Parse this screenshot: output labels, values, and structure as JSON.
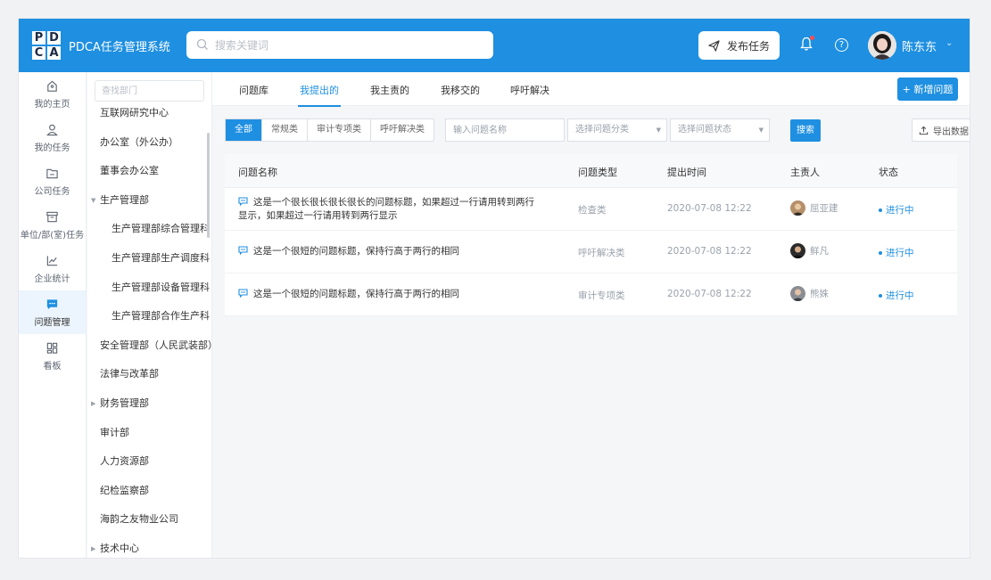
{
  "brand": {
    "logo_letters": [
      "P",
      "D",
      "C",
      "A"
    ],
    "title": "PDCA任务管理系统"
  },
  "header": {
    "search_placeholder": "搜索关键词",
    "publish_label": "发布任务",
    "user_name": "陈东东",
    "help_glyph": "?"
  },
  "nav": {
    "items": [
      {
        "label": "我的主页",
        "icon": "home-icon"
      },
      {
        "label": "我的任务",
        "icon": "user-icon"
      },
      {
        "label": "公司任务",
        "icon": "folder-icon"
      },
      {
        "label": "单位/部(室)任务",
        "icon": "archive-icon"
      },
      {
        "label": "企业统计",
        "icon": "chart-icon"
      },
      {
        "label": "问题管理",
        "icon": "message-icon",
        "active": true
      },
      {
        "label": "看板",
        "icon": "dashboard-icon"
      }
    ]
  },
  "dept": {
    "search_placeholder": "查找部门",
    "items": [
      {
        "label": "互联网研究中心",
        "level": 0
      },
      {
        "label": "办公室（外公办）",
        "level": 0
      },
      {
        "label": "董事会办公室",
        "level": 0
      },
      {
        "label": "生产管理部",
        "level": 0,
        "expanded": true
      },
      {
        "label": "生产管理部综合管理科",
        "level": 1
      },
      {
        "label": "生产管理部生产调度科",
        "level": 1
      },
      {
        "label": "生产管理部设备管理科",
        "level": 1
      },
      {
        "label": "生产管理部合作生产科",
        "level": 1
      },
      {
        "label": "安全管理部（人民武装部）",
        "level": 0
      },
      {
        "label": "法律与改革部",
        "level": 0
      },
      {
        "label": "财务管理部",
        "level": 0,
        "collapsed": true
      },
      {
        "label": "审计部",
        "level": 0
      },
      {
        "label": "人力资源部",
        "level": 0
      },
      {
        "label": "纪检监察部",
        "level": 0
      },
      {
        "label": "海韵之友物业公司",
        "level": 0
      },
      {
        "label": "技术中心",
        "level": 0,
        "collapsed": true
      }
    ]
  },
  "tabs": [
    "问题库",
    "我提出的",
    "我主责的",
    "我移交的",
    "呼吁解决"
  ],
  "active_tab": 1,
  "add_button": "+ 新增问题",
  "filters": {
    "segments": [
      "全部",
      "常规类",
      "审计专项类",
      "呼吁解决类"
    ],
    "active_segment": 0,
    "name_placeholder": "输入问题名称",
    "category_placeholder": "选择问题分类",
    "status_placeholder": "选择问题状态",
    "search_label": "搜索",
    "export_label": "导出数据"
  },
  "table": {
    "headers": [
      "问题名称",
      "问题类型",
      "提出时间",
      "主责人",
      "状态"
    ],
    "rows": [
      {
        "title": "这是一个很长很长很长很长的问题标题，如果超过一行请用转到两行显示，如果超过一行请用转到两行显示",
        "type": "检查类",
        "time": "2020-07-08 12:22",
        "owner": "屈亚建",
        "status": "进行中"
      },
      {
        "title": "这是一个很短的问题标题，保持行高于两行的相同",
        "type": "呼吁解决类",
        "time": "2020-07-08 12:22",
        "owner": "鲜凡",
        "status": "进行中"
      },
      {
        "title": "这是一个很短的问题标题，保持行高于两行的相同",
        "type": "审计专项类",
        "time": "2020-07-08 12:22",
        "owner": "熊姝",
        "status": "进行中"
      }
    ]
  },
  "colors": {
    "primary": "#1e8fe1",
    "header_bg": "#1e8fe1",
    "logo_dark": "#1b2a44",
    "notification_dot": "#ff4d4f"
  }
}
